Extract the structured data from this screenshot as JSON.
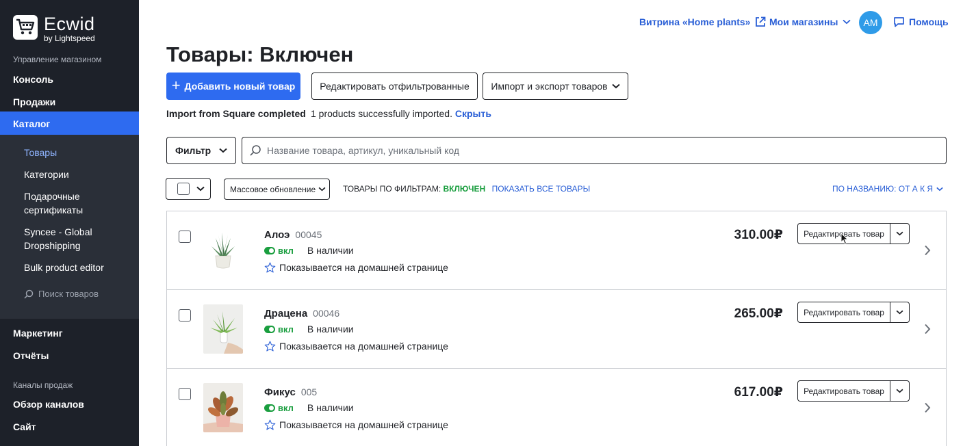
{
  "brand": {
    "name": "Ecwid",
    "sub": "by Lightspeed"
  },
  "sidebar": {
    "section_store": "Управление магазином",
    "items": [
      "Консоль",
      "Продажи"
    ],
    "active": "Каталог",
    "subitems": [
      "Товары",
      "Категории",
      "Подарочные сертификаты",
      "Syncee - Global Dropshipping",
      "Bulk product editor"
    ],
    "search_placeholder": "Поиск товаров",
    "items2": [
      "Маркетинг",
      "Отчёты"
    ],
    "section_channels": "Каналы продаж",
    "items3": [
      "Обзор каналов",
      "Сайт"
    ]
  },
  "header": {
    "storefront": "Витрина «Home plants»",
    "stores": "Мои магазины",
    "avatar": "AM",
    "help": "Помощь"
  },
  "page": {
    "title": "Товары: Включен",
    "add_button": "Добавить новый товар",
    "edit_filtered": "Редактировать отфильтрованные",
    "import_export": "Импорт и экспорт товаров",
    "notice_title": "Import from Square completed",
    "notice_text": "1 products successfully imported.",
    "notice_hide": "Скрыть",
    "filter": "Фильтр",
    "search_placeholder": "Название товара, артикул, уникальный код",
    "mass_update": "Массовое обновление",
    "filter_status_prefix": "ТОВАРЫ ПО ФИЛЬТРАМ:",
    "filter_status_value": "ВКЛЮЧЕН",
    "show_all": "ПОКАЗАТЬ ВСЕ ТОВАРЫ",
    "sort": "ПО НАЗВАНИЮ: ОТ А К Я"
  },
  "products": [
    {
      "name": "Алоэ",
      "sku": "00045",
      "enabled": "вкл",
      "stock": "В наличии",
      "featured": "Показывается на домашней странице",
      "price": "310.00₽",
      "edit": "Редактировать товар"
    },
    {
      "name": "Драцена",
      "sku": "00046",
      "enabled": "вкл",
      "stock": "В наличии",
      "featured": "Показывается на домашней странице",
      "price": "265.00₽",
      "edit": "Редактировать товар"
    },
    {
      "name": "Фикус",
      "sku": "005",
      "enabled": "вкл",
      "stock": "В наличии",
      "featured": "Показывается на домашней странице",
      "price": "617.00₽",
      "edit": "Редактировать товар"
    }
  ]
}
